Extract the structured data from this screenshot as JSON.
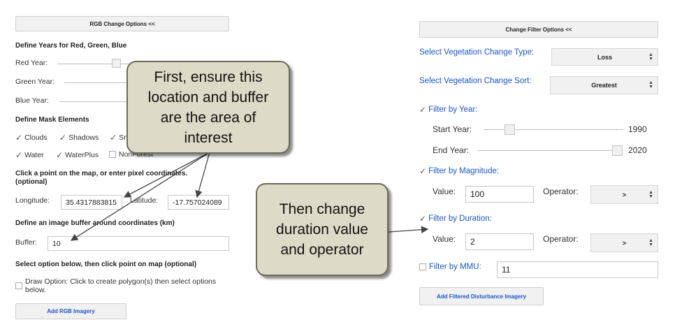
{
  "left_panel": {
    "rgb_options_button": "RGB Change Options <<",
    "years_heading": "Define Years for Red, Green, Blue",
    "red_year_label": "Red Year:",
    "green_year_label": "Green Year:",
    "blue_year_label": "Blue Year:",
    "mask_heading": "Define Mask Elements",
    "mask_items": [
      "Clouds",
      "Shadows",
      "Sn",
      "Water",
      "WaterPlus",
      "NonForest"
    ],
    "point_heading_line1": "Click a point on the map, or enter pixel coordinates.",
    "point_heading_line2": "(optional)",
    "longitude_label": "Longitude:",
    "longitude_value": "35.4317883815",
    "latitude_label": "Latitude:",
    "latitude_value": "-17.757024089",
    "buffer_heading": "Define an image buffer around coordinates (km)",
    "buffer_label": "Buffer:",
    "buffer_value": "10",
    "select_heading": "Select option below, then click point on map (optional)",
    "draw_option_line1": "Draw Option: Click to create polygon(s) then select options",
    "draw_option_line2": "below.",
    "add_rgb_button": "Add RGB Imagery"
  },
  "right_panel": {
    "filter_options_button": "Change Filter Options <<",
    "veg_type_label": "Select Vegetation Change Type:",
    "veg_type_value": "Loss",
    "veg_sort_label": "Select Vegetation Change Sort:",
    "veg_sort_value": "Greatest",
    "filter_year_label": "Filter by Year:",
    "start_year_label": "Start Year:",
    "start_year_value": "1990",
    "end_year_label": "End Year:",
    "end_year_value": "2020",
    "filter_magnitude_label": "Filter by Magnitude:",
    "magnitude_value_label": "Value:",
    "magnitude_value": "100",
    "magnitude_operator_label": "Operator:",
    "magnitude_operator": ">",
    "filter_duration_label": "Filter by Duration:",
    "duration_value_label": "Value:",
    "duration_value": "2",
    "duration_operator_label": "Operator:",
    "duration_operator": ">",
    "filter_mmu_label": "Filter by MMU:",
    "mmu_value": "11",
    "add_filtered_button": "Add Filtered Disturbance Imagery"
  },
  "callouts": {
    "first": [
      "First, ensure this",
      "location and buffer",
      "are the area of",
      "interest"
    ],
    "second": [
      "Then change",
      "duration value",
      "and operator"
    ]
  },
  "colors": {
    "accent_blue": "#1a56c7",
    "callout_fill": "#dcdbc7",
    "button_bg": "#f1f1f1"
  }
}
